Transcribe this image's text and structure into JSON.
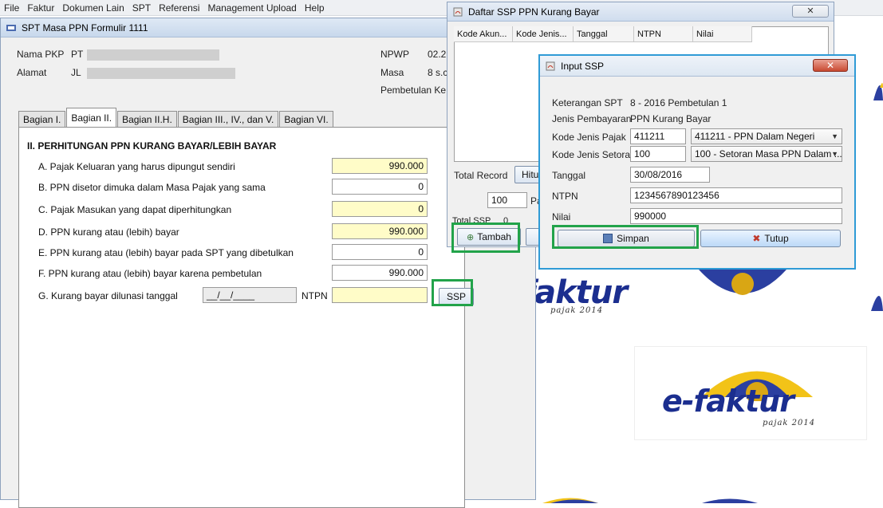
{
  "menubar": [
    "File",
    "Faktur",
    "Dokumen Lain",
    "SPT",
    "Referensi",
    "Management Upload",
    "Help"
  ],
  "brand": {
    "logo_word": "e-faktur",
    "logo_tag": "pajak 2014"
  },
  "main_window": {
    "title": "SPT Masa PPN Formulir 1111",
    "nama_pkp_label": "Nama PKP",
    "nama_pkp_value": "PT",
    "alamat_label": "Alamat",
    "alamat_value": "JL",
    "npwp_label": "NPWP",
    "npwp_value": "02.2",
    "masa_label": "Masa",
    "masa_value": "8 s.c",
    "pembetulan_label": "Pembetulan Ke",
    "tabs": [
      "Bagian I.",
      "Bagian II.",
      "Bagian II.H.",
      "Bagian III., IV., dan V.",
      "Bagian VI."
    ],
    "section_title": "II. PERHITUNGAN PPN KURANG BAYAR/LEBIH BAYAR",
    "rows": [
      {
        "label": "A. Pajak Keluaran yang harus dipungut sendiri",
        "value": "990.000"
      },
      {
        "label": "B. PPN disetor dimuka dalam Masa Pajak yang sama",
        "value": "0"
      },
      {
        "label": "C. Pajak Masukan yang dapat diperhitungkan",
        "value": "0"
      },
      {
        "label": "D. PPN kurang atau (lebih) bayar",
        "value": "990.000"
      },
      {
        "label": "E. PPN kurang atau (lebih) bayar pada SPT yang dibetulkan",
        "value": "0"
      },
      {
        "label": "F. PPN kurang atau (lebih) bayar karena pembetulan",
        "value": "990.000"
      }
    ],
    "row_g_label": "G. Kurang bayar dilunasi tanggal",
    "row_g_date": "__/__/____",
    "row_g_ntpn_label": "NTPN",
    "ssp_button": "SSP"
  },
  "daftar_window": {
    "title": "Daftar SSP PPN Kurang Bayar",
    "columns": [
      "Kode Akun...",
      "Kode Jenis...",
      "Tanggal",
      "NTPN",
      "Nilai"
    ],
    "total_record_label": "Total Record",
    "hitung_button": "Hitun",
    "page_size": "100",
    "page_label": "Pa",
    "total_ssp_label": "Total SSP",
    "total_ssp_value": "0",
    "tambah_button": "Tambah"
  },
  "input_window": {
    "title": "Input SSP",
    "keterangan_label": "Keterangan SPT",
    "keterangan_value": "8 - 2016 Pembetulan 1",
    "jenis_label": "Jenis Pembayaran",
    "jenis_value": "PPN Kurang Bayar",
    "kode_pajak_label": "Kode Jenis Pajak",
    "kode_pajak_value": "411211",
    "kode_pajak_option": "411211 - PPN Dalam Negeri",
    "kode_setoran_label": "Kode Jenis Setoran",
    "kode_setoran_value": "100",
    "kode_setoran_option": "100 - Setoran Masa PPN Dalam ...",
    "tanggal_label": "Tanggal",
    "tanggal_value": "30/08/2016",
    "ntpn_label": "NTPN",
    "ntpn_value": "1234567890123456",
    "nilai_label": "Nilai",
    "nilai_value": "990000",
    "simpan_button": "Simpan",
    "tutup_button": "Tutup"
  },
  "colors": {
    "highlight": "#22a34a",
    "yellow_field": "#fffcc8",
    "dialog_border": "#2f9bd6"
  }
}
